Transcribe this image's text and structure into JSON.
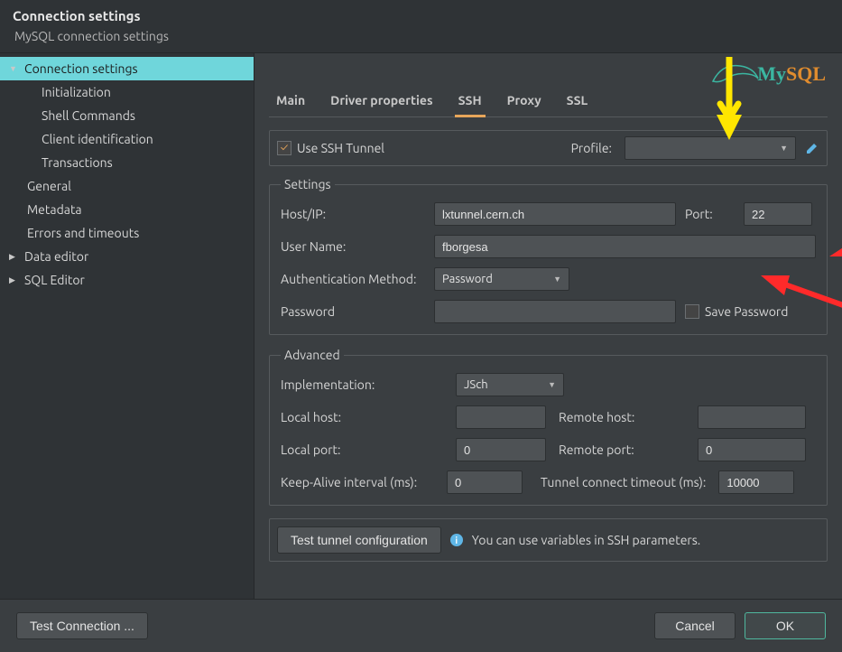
{
  "header": {
    "title": "Connection settings",
    "subtitle": "MySQL connection settings"
  },
  "logo": {
    "my": "My",
    "sql": "SQL"
  },
  "sidebar": [
    {
      "label": "Connection settings",
      "level": 1,
      "arrow": "down",
      "selected": true
    },
    {
      "label": "Initialization",
      "level": 2
    },
    {
      "label": "Shell Commands",
      "level": 2
    },
    {
      "label": "Client identification",
      "level": 2
    },
    {
      "label": "Transactions",
      "level": 2
    },
    {
      "label": "General",
      "level": 1,
      "no_arrow": true
    },
    {
      "label": "Metadata",
      "level": 1,
      "no_arrow": true
    },
    {
      "label": "Errors and timeouts",
      "level": 1,
      "no_arrow": true
    },
    {
      "label": "Data editor",
      "level": 1,
      "arrow": "right"
    },
    {
      "label": "SQL Editor",
      "level": 1,
      "arrow": "right"
    }
  ],
  "tabs": [
    {
      "label": "Main"
    },
    {
      "label": "Driver properties"
    },
    {
      "label": "SSH",
      "active": true
    },
    {
      "label": "Proxy"
    },
    {
      "label": "SSL"
    }
  ],
  "ssh": {
    "use_tunnel_label": "Use SSH Tunnel",
    "use_tunnel_checked": true,
    "profile_label": "Profile:",
    "profile_value": "",
    "settings_legend": "Settings",
    "host_label": "Host/IP:",
    "host_value": "lxtunnel.cern.ch",
    "port_label": "Port:",
    "port_value": "22",
    "user_label": "User Name:",
    "user_value": "fborgesa",
    "auth_method_label": "Authentication Method:",
    "auth_method_value": "Password",
    "password_label": "Password",
    "password_value": "",
    "save_password_label": "Save Password",
    "save_password_checked": false
  },
  "adv": {
    "legend": "Advanced",
    "impl_label": "Implementation:",
    "impl_value": "JSch",
    "local_host_label": "Local host:",
    "local_host_value": "",
    "remote_host_label": "Remote host:",
    "remote_host_value": "",
    "local_port_label": "Local port:",
    "local_port_value": "0",
    "remote_port_label": "Remote port:",
    "remote_port_value": "0",
    "keepalive_label": "Keep-Alive interval (ms):",
    "keepalive_value": "0",
    "timeout_label": "Tunnel connect timeout (ms):",
    "timeout_value": "10000"
  },
  "test_row": {
    "button": "Test tunnel configuration",
    "hint": "You can use variables in SSH parameters."
  },
  "footer": {
    "test_connection": "Test Connection ...",
    "cancel": "Cancel",
    "ok": "OK"
  }
}
